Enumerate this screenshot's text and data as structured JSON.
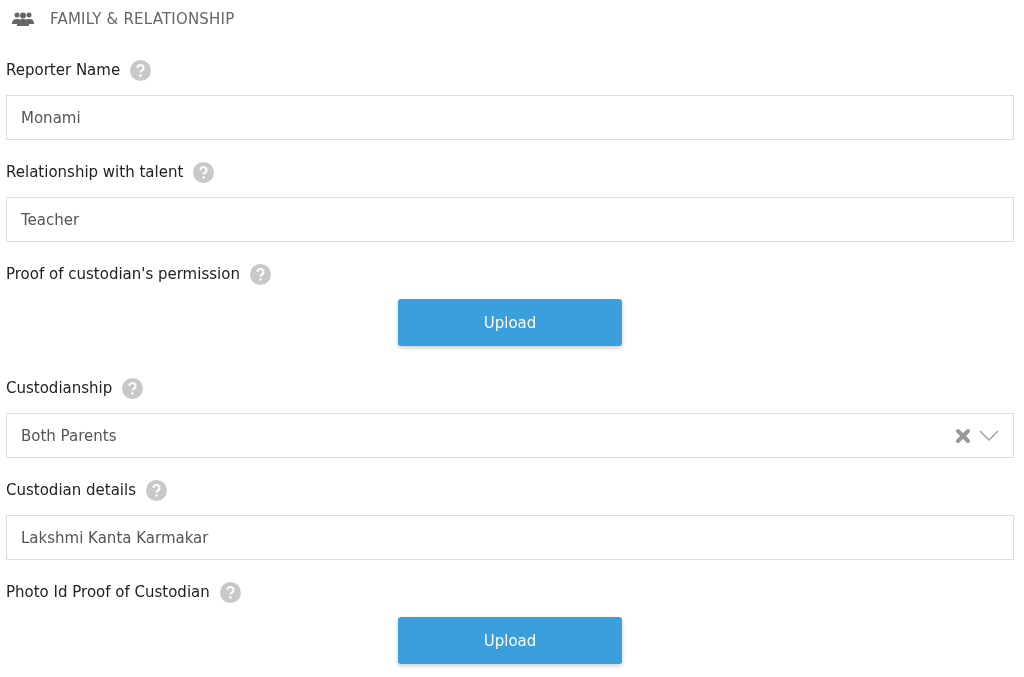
{
  "section": {
    "title": "FAMILY & RELATIONSHIP"
  },
  "fields": [
    {
      "kind": "text",
      "label": "Reporter Name",
      "value": "Monami"
    },
    {
      "kind": "text",
      "label": "Relationship with talent",
      "value": "Teacher"
    },
    {
      "kind": "upload",
      "label": "Proof of custodian's permission",
      "button": "Upload"
    },
    {
      "kind": "select",
      "label": "Custodianship",
      "value": "Both Parents"
    },
    {
      "kind": "text",
      "label": "Custodian details",
      "value": "Lakshmi Kanta Karmakar"
    },
    {
      "kind": "upload",
      "label": "Photo Id Proof of Custodian",
      "button": "Upload"
    }
  ]
}
